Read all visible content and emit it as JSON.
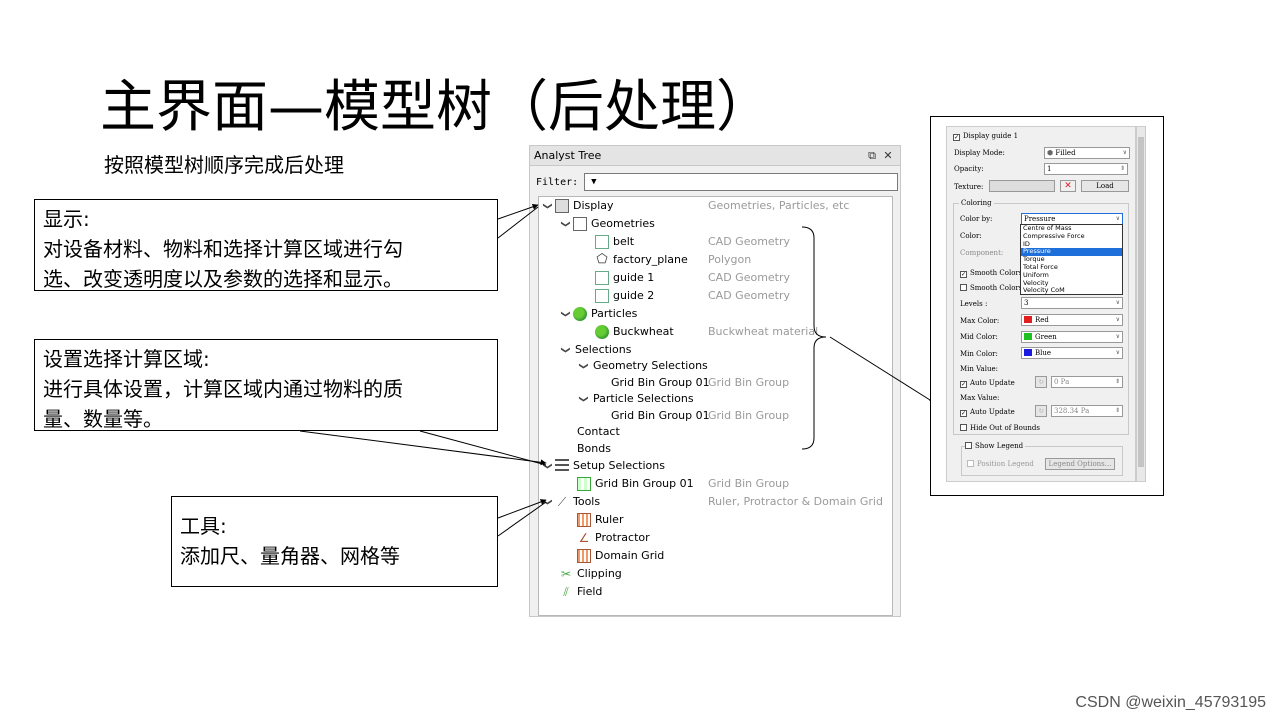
{
  "slide": {
    "title": "主界面—模型树（后处理）",
    "subtitle": "按照模型树顺序完成后处理",
    "watermark": "CSDN @weixin_45793195"
  },
  "callouts": {
    "display": {
      "line1": "显示:",
      "line2": "对设备材料、物料和选择计算区域进行勾",
      "line3": "选、改变透明度以及参数的选择和显示。"
    },
    "setup": {
      "line1": "设置选择计算区域:",
      "line2": "进行具体设置，计算区域内通过物料的质",
      "line3": "量、数量等。"
    },
    "tools": {
      "line1": "工具:",
      "line2": "添加尺、量角器、网格等"
    }
  },
  "analyst_tree": {
    "title": "Analyst Tree",
    "float_icon": "⧉",
    "close_icon": "✕",
    "filter_label": "Filter:",
    "filter_value": "▼",
    "rows": {
      "display": {
        "label": "Display",
        "desc": "Geometries, Particles, etc"
      },
      "geometries": {
        "label": "Geometries"
      },
      "belt": {
        "label": "belt",
        "desc": "CAD Geometry"
      },
      "factory_plane": {
        "label": "factory_plane",
        "desc": "Polygon"
      },
      "guide1": {
        "label": "guide 1",
        "desc": "CAD Geometry"
      },
      "guide2": {
        "label": "guide 2",
        "desc": "CAD Geometry"
      },
      "particles": {
        "label": "Particles"
      },
      "buckwheat": {
        "label": "Buckwheat",
        "desc": "Buckwheat material"
      },
      "selections": {
        "label": "Selections"
      },
      "geometry_selections": {
        "label": "Geometry Selections"
      },
      "gbg_geom": {
        "label": "Grid Bin Group 01",
        "desc": "Grid Bin Group"
      },
      "particle_selections": {
        "label": "Particle Selections"
      },
      "gbg_part": {
        "label": "Grid Bin Group 01",
        "desc": "Grid Bin Group"
      },
      "contact": {
        "label": "Contact"
      },
      "bonds": {
        "label": "Bonds"
      },
      "setup_selections": {
        "label": "Setup Selections"
      },
      "gbg_setup": {
        "label": "Grid Bin Group 01",
        "desc": "Grid Bin Group"
      },
      "tools": {
        "label": "Tools",
        "desc": "Ruler, Protractor & Domain Grid"
      },
      "ruler": {
        "label": "Ruler"
      },
      "protractor": {
        "label": "Protractor"
      },
      "domain_grid": {
        "label": "Domain Grid"
      },
      "clipping": {
        "label": "Clipping"
      },
      "field": {
        "label": "Field"
      }
    },
    "chevron_expanded": "❯"
  },
  "properties": {
    "display_guide": "Display guide 1",
    "display_mode_label": "Display Mode:",
    "display_mode_value": "Filled",
    "opacity_label": "Opacity:",
    "opacity_value": "1",
    "texture_label": "Texture:",
    "load_button": "Load",
    "coloring_group": "Coloring",
    "color_by_label": "Color by:",
    "color_by_value": "Pressure",
    "color_label": "Color:",
    "component_label": "Component:",
    "color_by_options": [
      "Centre of Mass",
      "Compressive Force",
      "ID",
      "Pressure",
      "Torque",
      "Total Force",
      "Uniform",
      "Velocity",
      "Velocity CoM"
    ],
    "selected_option": "Pressure",
    "smooth_colors_1": "Smooth Colors",
    "smooth_colors_2": "Smooth Colors",
    "levels_label": "Levels :",
    "levels_value": "3",
    "max_color_label": "Max Color:",
    "max_color_value": "Red",
    "mid_color_label": "Mid Color:",
    "mid_color_value": "Green",
    "min_color_label": "Min Color:",
    "min_color_value": "Blue",
    "min_value_label": "Min Value:",
    "auto_update_1": "Auto Update",
    "min_value": "0 Pa",
    "max_value_label": "Max Value:",
    "auto_update_2": "Auto Update",
    "max_value": "328.34 Pa",
    "hide_out_of_bounds": "Hide Out of Bounds",
    "show_legend": "Show Legend",
    "position_legend": "Position Legend",
    "legend_options_button": "Legend Options...",
    "colors": {
      "red": "#e02020",
      "green": "#20c020",
      "blue": "#1a1ae0"
    }
  }
}
